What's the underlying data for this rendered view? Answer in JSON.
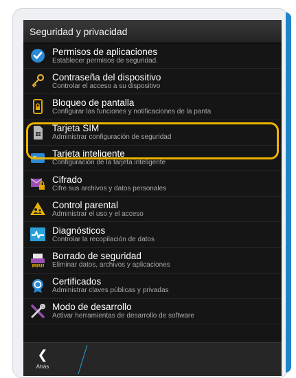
{
  "header": {
    "title": "Seguridad y privacidad"
  },
  "items": [
    {
      "id": "app-permissions",
      "icon": "checkmark-shield-icon",
      "title": "Permisos de aplicaciones",
      "subtitle": "Establecer permisos de seguridad."
    },
    {
      "id": "device-password",
      "icon": "keys-icon",
      "title": "Contraseña del dispositivo",
      "subtitle": "Controlar el acceso a su dispositivo"
    },
    {
      "id": "lock-screen",
      "icon": "lock-screen-icon",
      "title": "Bloqueo de pantalla",
      "subtitle": "Configurar las funciones y notificaciones de la panta"
    },
    {
      "id": "sim-card",
      "icon": "sim-card-icon",
      "title": "Tarjeta SIM",
      "subtitle": "Administrar configuración de seguridad"
    },
    {
      "id": "smart-card",
      "icon": "smart-card-icon",
      "title": "Tarjeta inteligente",
      "subtitle": "Configuración de la tarjeta inteligente"
    },
    {
      "id": "encryption",
      "icon": "encrypted-envelope-icon",
      "title": "Cifrado",
      "subtitle": "Cifre sus archivos y datos personales"
    },
    {
      "id": "parental-control",
      "icon": "parental-control-icon",
      "title": "Control parental",
      "subtitle": "Administrar el uso y el acceso"
    },
    {
      "id": "diagnostics",
      "icon": "pulse-icon",
      "title": "Diagnósticos",
      "subtitle": "Controlar la recopilación de datos"
    },
    {
      "id": "security-wipe",
      "icon": "shredder-icon",
      "title": "Borrado de seguridad",
      "subtitle": "Eliminar datos, archivos y aplicaciones"
    },
    {
      "id": "certificates",
      "icon": "certificate-badge-icon",
      "title": "Certificados",
      "subtitle": "Administrar claves públicas y privadas"
    },
    {
      "id": "developer-mode",
      "icon": "developer-tools-icon",
      "title": "Modo de desarrollo",
      "subtitle": "Activar herramientas de desarrollo de software"
    }
  ],
  "bottom_bar": {
    "back_label": "Atrás",
    "back_icon": "chevron-left-icon"
  },
  "colors": {
    "accent": "#1c86c9",
    "highlight": "#f0b400",
    "screen_bg": "#151515",
    "header_bg": "#2e2e2e"
  }
}
